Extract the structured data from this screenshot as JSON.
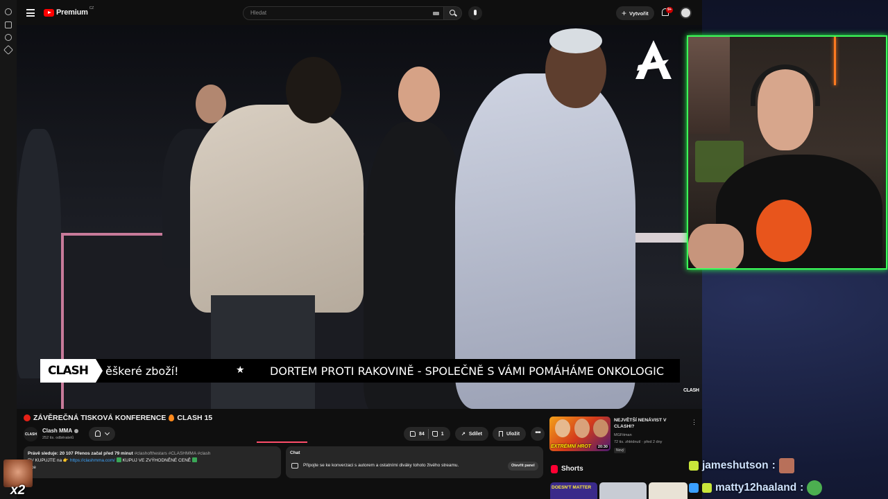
{
  "topbar": {
    "logo_text": "Premium",
    "logo_country": "CZ",
    "search_placeholder": "Hledat",
    "create_label": "Vytvořit",
    "notifications_count": "9+"
  },
  "video": {
    "ticker_logo": "CLASH",
    "ticker_text_left": "ěškeré zboží!",
    "ticker_text_right": "DORTEM PROTI RAKOVINĚ - SPOLEČNĚ S VÁMI POMÁHÁME ONKOLOGIC",
    "corner_logo": "CLASH"
  },
  "details": {
    "title_left": "ZÁVĚREČNÁ TISKOVÁ KONFERENCE",
    "title_right": "CLASH 15",
    "channel_avatar": "CLASH",
    "channel_name": "Clash MMA",
    "subscribers": "252 tis. odběratelů",
    "likes": "84",
    "dislikes": "1",
    "share_label": "Sdílet",
    "save_label": "Uložit"
  },
  "description": {
    "line1_viewers": "Právě sleduje: 20 107  Přenos začal před 79 minut",
    "line1_tags": "#clashofthestars #CLASHMMA #clash",
    "line2_prefix": "PV KUPUJTE na 👉",
    "line2_link": "https://clashmma.com/",
    "line2_suffix": "KUPUJ VE ZVÝHODNĚNÉ CENĚ",
    "more": "více"
  },
  "chat": {
    "title": "Chat",
    "description": "Připojte se ke konverzaci s autorem a ostatními diváky tohoto živého streamu.",
    "open_label": "Otevřít panel"
  },
  "recommended": {
    "thumb_label": "EXTRÉMNÍ HROT",
    "duration": "20:30",
    "title": "NEJVĚTŠÍ NENÁVIST V CLASHI?",
    "channel": "MGFitman",
    "meta": "72 tis. zhlédnutí · před 2 dny",
    "badge": "Nový"
  },
  "shorts": {
    "label": "Shorts",
    "first_label": "DOESN'T MATTER"
  },
  "overlay_chat": [
    {
      "user": "jameshutson",
      "sep": ":"
    },
    {
      "user": "matty12haaland",
      "sep": ":"
    }
  ],
  "reaction": {
    "count": "x2"
  },
  "colors": {
    "brand_red": "#ff0000",
    "cam_border": "#3cff5a",
    "link": "#3ea6ff"
  }
}
